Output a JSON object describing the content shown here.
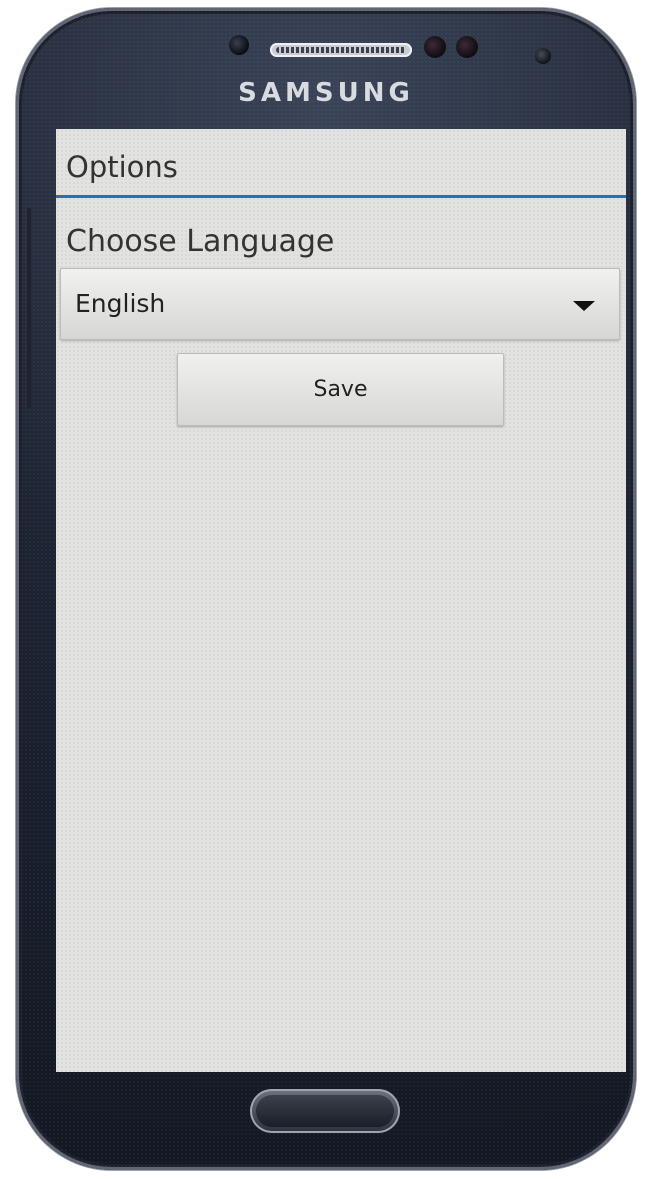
{
  "device": {
    "brand": "SAMSUNG"
  },
  "app": {
    "title": "Options",
    "language_label": "Choose Language",
    "language_select": {
      "selected": "English"
    },
    "save_label": "Save"
  },
  "colors": {
    "accent": "#1e72b8",
    "screen_background": "#e2e3e0",
    "text": "#333333"
  }
}
